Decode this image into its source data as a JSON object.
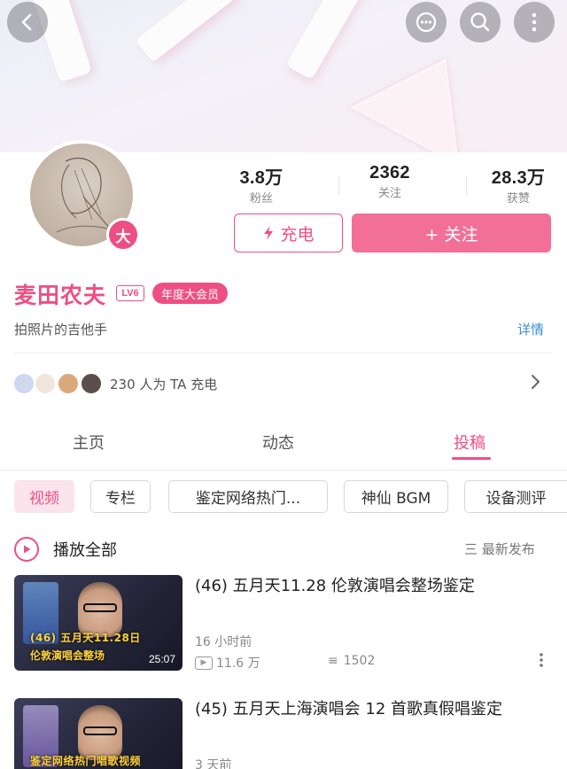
{
  "header": {
    "back_icon": "chevron-left-icon",
    "chat_icon": "chat-bubble-icon",
    "search_icon": "search-icon",
    "more_icon": "more-vertical-icon"
  },
  "profile": {
    "badge": "大",
    "stats": [
      {
        "value": "3.8万",
        "label": "粉丝"
      },
      {
        "value": "2362",
        "label": "关注"
      },
      {
        "value": "28.3万",
        "label": "获赞"
      }
    ],
    "charge_button": "充电",
    "follow_button": "+ 关注",
    "username": "麦田农夫",
    "level": "LV6",
    "member_badge": "年度大会员",
    "bio": "拍照片的吉他手",
    "details_link": "详情",
    "charge_summary": "230 人为 TA 充电"
  },
  "tabs": [
    "主页",
    "动态",
    "投稿"
  ],
  "categories": [
    "视频",
    "专栏",
    "鉴定网络热门...",
    "神仙 BGM",
    "设备测评"
  ],
  "list_header": {
    "play_all": "播放全部",
    "sort": "三 最新发布"
  },
  "videos": [
    {
      "title": "(46) 五月天11.28 伦敦演唱会整场鉴定",
      "thumb_line1": "(46) 五月天11.28日",
      "thumb_line2": "伦敦演唱会整场",
      "duration": "25:07",
      "time": "16 小时前",
      "views": "11.6 万",
      "danmaku": "1502"
    },
    {
      "title": "(45) 五月天上海演唱会 12 首歌真假唱鉴定",
      "thumb_line1": "鉴定网络热门唱歌视频",
      "time": "3 天前"
    }
  ],
  "colors": {
    "accent": "#ee4f83",
    "follow_bg": "#f26f98",
    "link": "#3a8dd6"
  }
}
